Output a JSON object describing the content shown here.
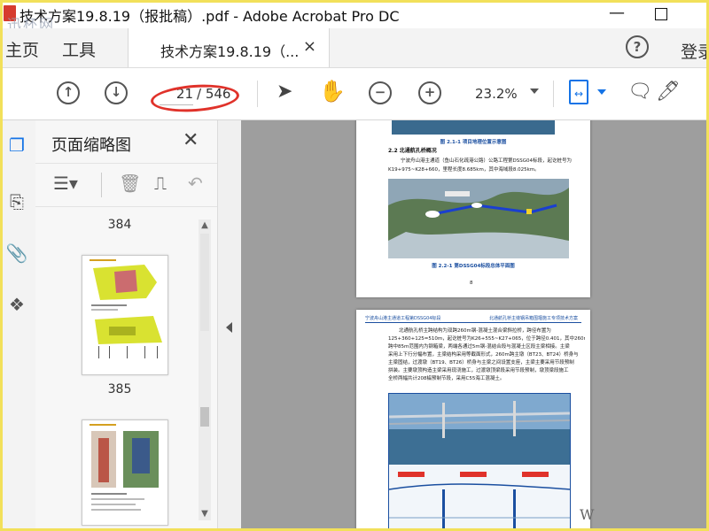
{
  "window": {
    "title": "技术方案19.8.19（报批稿）.pdf - Adobe Acrobat Pro DC",
    "watermark_top_left": "迅杯网",
    "minimize_glyph": "—"
  },
  "tabs": {
    "home": "主页",
    "tools": "工具",
    "document": "技术方案19.8.19（...",
    "close_glyph": "×",
    "signin": "登录",
    "help_glyph": "?"
  },
  "toolbar": {
    "prev_glyph": "↑",
    "next_glyph": "↓",
    "current_page": "21",
    "total_pages": "/ 546",
    "zoom": "23.2%",
    "icons": [
      "arrow-up-icon",
      "arrow-down-icon",
      "select-cursor-icon",
      "hand-tool-icon",
      "zoom-out-icon",
      "zoom-in-icon",
      "fit-page-icon",
      "comment-icon",
      "link-sign-icon"
    ],
    "cursor_glyph": "➤",
    "hand_glyph": "✋",
    "zoom_out_glyph": "−",
    "zoom_in_glyph": "+",
    "comment_glyph": "🗨",
    "sign_glyph": "🖊"
  },
  "left_rail": {
    "icons": [
      "page-thumbnails-icon",
      "bookmarks-icon",
      "attachments-icon",
      "layers-icon"
    ],
    "glyphs": [
      "❐",
      "⎘",
      "📎",
      "❖"
    ]
  },
  "thumbnail_panel": {
    "title": "页面缩略图",
    "close_glyph": "✕",
    "options_glyph": "☰▾",
    "delete_glyph": "🗑",
    "insert_glyph": "⎍",
    "undo_glyph": "↶",
    "page_labels": [
      "384",
      "385"
    ],
    "up_glyph": "▲",
    "down_glyph": "▼"
  },
  "document": {
    "page1": {
      "figure_caption_top": "图 2.1-1 项目地理位置示意图",
      "section_heading": "2.2 北通航孔桥概况",
      "body_line1": "宁波舟山港主通道（鱼山石化疏港公路）公路工程第DSSG04标段，起讫桩号为",
      "body_line2": "K19+975~K28+660，里程长度8.685km，其中海域段8.025km。",
      "figure_caption_bottom": "图 2.2-1 第DSSG04标段总体平面图",
      "page_number": "8"
    },
    "page2": {
      "header_left": "宁波舟山港主通道工程第DSSG04标段",
      "header_right": "北通航孔桥主墩钢吊箱围堰施工专项技术方案",
      "body_lines": [
        "北通航孔桥主跨结构为双跨260m钢-混凝土混合梁斜拉桥，跨径布置为",
        "125+360+125=510m，起讫桩号为K26+555~K27+065，位于跨径0.401，其中260m跨",
        "跨中85m范围内为钢箱梁，两端各通过5m钢-混结合段与混凝土区段主梁相接。主梁",
        "采用上下行分幅布置，主梁结构采用等截面形式，260m跨主墩（BT23、BT24）桥身与",
        "主梁固结，过渡墩（BT19、BT26）桥身与主梁之间设置支座，主梁主要采用节段预制",
        "拼装。主要墩顶构造主梁采用现浇施工，过渡墩顶梁段采用节段预制，墩顶梁段施工",
        "全桥两幅共计208榀预制节段，采用C55海工混凝土。"
      ]
    }
  },
  "watermark_bottom_right": "W",
  "colors": {
    "accent": "#1473e6",
    "annotation_red": "#e0322a",
    "acrobat_red": "#d63b2f",
    "frame_yellow": "#f2e05a",
    "doc_background": "#9e9e9e"
  }
}
